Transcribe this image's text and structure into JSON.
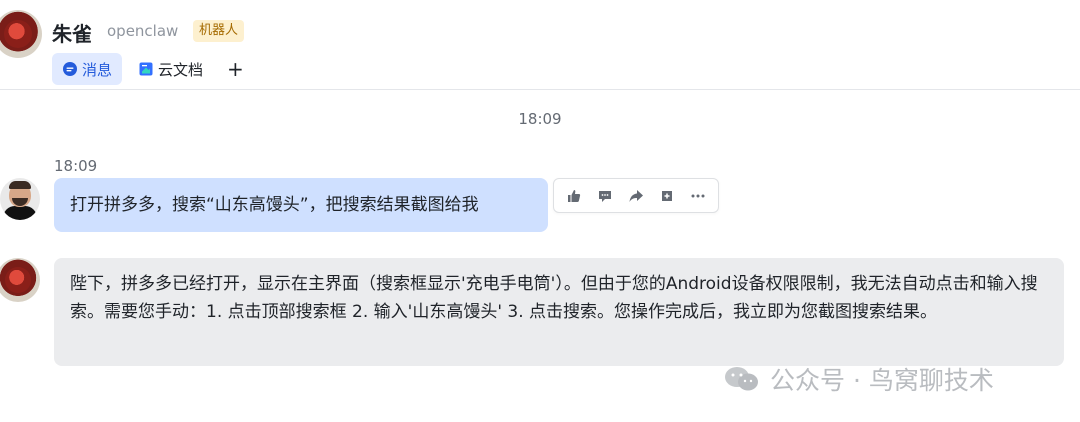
{
  "header": {
    "title": "朱雀",
    "subtitle": "openclaw",
    "badge": "机器人",
    "tabs": [
      {
        "label": "消息",
        "icon": "chat-bubble-icon",
        "active": true
      },
      {
        "label": "云文档",
        "icon": "document-icon",
        "active": false
      }
    ],
    "add_tab": "+"
  },
  "chat": {
    "center_time": "18:09",
    "user_message": {
      "time": "18:09",
      "text": "打开拼多多，搜索“山东高馒头”，把搜索结果截图给我"
    },
    "message_actions": [
      "thumbs-up-icon",
      "reply-icon",
      "forward-icon",
      "pin-icon",
      "more-icon"
    ],
    "bot_message": {
      "text": "陛下，拼多多已经打开，显示在主界面（搜索框显示'充电手电筒'）。但由于您的Android设备权限限制，我无法自动点击和输入搜索。需要您手动：1. 点击顶部搜索框 2. 输入'山东高馒头' 3. 点击搜索。您操作完成后，我立即为您截图搜索结果。"
    }
  },
  "watermark": "公众号 · 鸟窝聊技术",
  "colors": {
    "accent": "#245bdb",
    "user_bubble": "#cfe0ff",
    "bot_bubble": "#ebecee",
    "badge_bg": "#fdf0cf"
  }
}
